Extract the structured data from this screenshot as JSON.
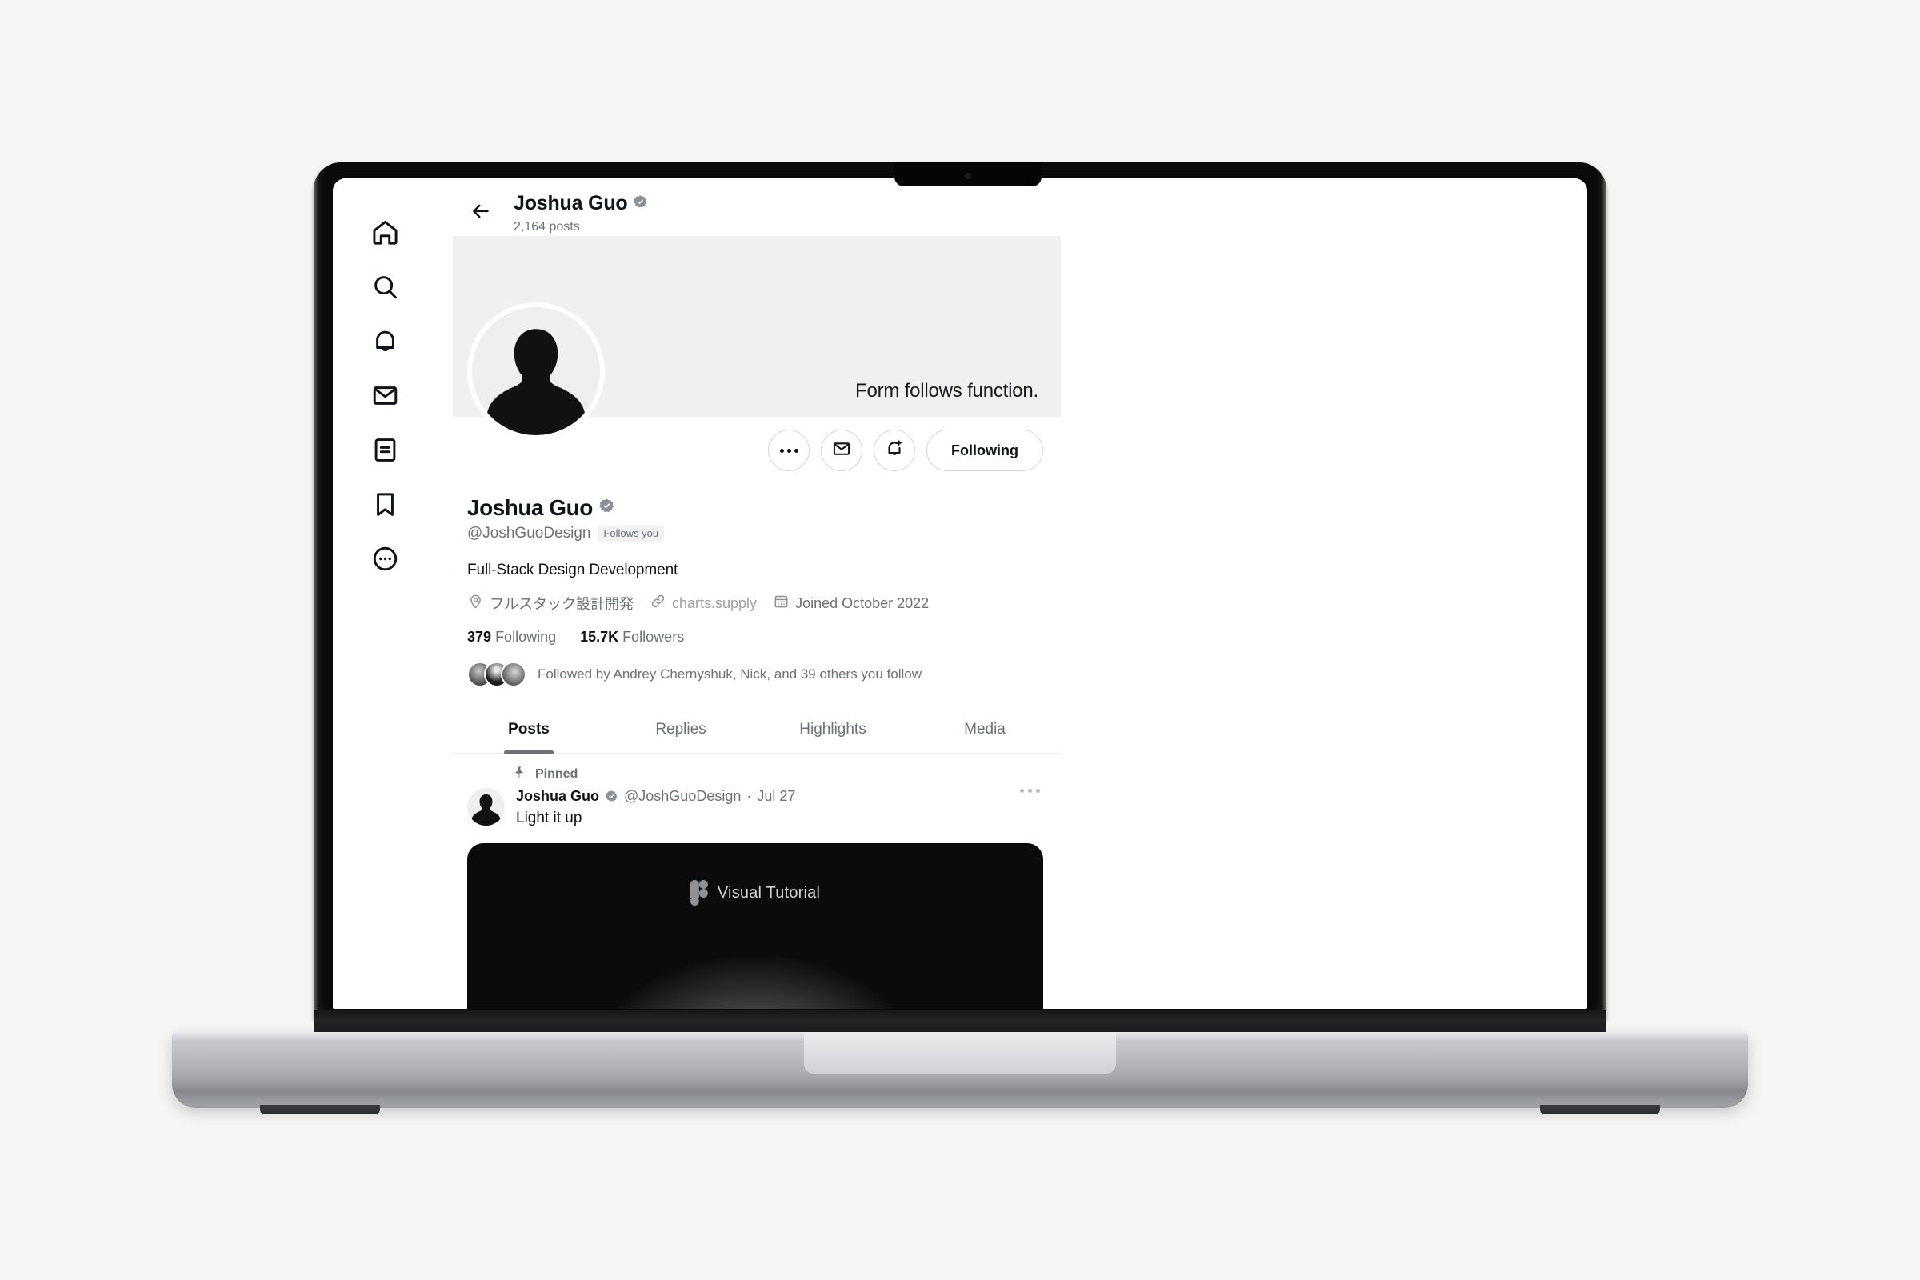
{
  "sidebar": {
    "items": [
      {
        "name": "home",
        "icon": "home-icon",
        "label": "Home"
      },
      {
        "name": "explore",
        "icon": "search-icon",
        "label": "Explore"
      },
      {
        "name": "notifications",
        "icon": "bell-icon",
        "label": "Notifications"
      },
      {
        "name": "messages",
        "icon": "envelope-icon",
        "label": "Messages"
      },
      {
        "name": "grok",
        "icon": "list-document-icon",
        "label": "Grok"
      },
      {
        "name": "bookmarks",
        "icon": "bookmark-icon",
        "label": "Bookmarks"
      },
      {
        "name": "more",
        "icon": "more-circle-icon",
        "label": "More"
      }
    ]
  },
  "topbar": {
    "back_icon": "arrow-left-icon",
    "title": "Joshua Guo",
    "verified_icon": "verified-badge-icon",
    "posts_count": "2,164 posts"
  },
  "banner": {
    "quote": "Form follows function.",
    "color": "#f0f0f0"
  },
  "actions": {
    "more_label": "More",
    "more_icon": "ellipsis-icon",
    "message_icon": "envelope-icon",
    "notify_icon": "bell-plus-icon",
    "follow_label": "Following"
  },
  "profile": {
    "display_name": "Joshua Guo",
    "verified_icon": "verified-badge-icon",
    "handle": "@JoshGuoDesign",
    "follows_you": "Follows you",
    "bio": "Full-Stack Design Development",
    "location": "フルスタック設計開発",
    "location_icon": "location-pin-icon",
    "website": "charts.supply",
    "website_icon": "link-icon",
    "joined": "Joined October 2022",
    "joined_icon": "calendar-icon",
    "following_count": "379",
    "following_label": "Following",
    "followers_count": "15.7K",
    "followers_label": "Followers",
    "followed_by": "Followed by Andrey Chernyshuk, Nick, and 39 others you follow"
  },
  "tabs": [
    {
      "label": "Posts",
      "active": true
    },
    {
      "label": "Replies",
      "active": false
    },
    {
      "label": "Highlights",
      "active": false
    },
    {
      "label": "Media",
      "active": false
    }
  ],
  "post": {
    "pinned_label": "Pinned",
    "pinned_icon": "pin-icon",
    "author": "Joshua Guo",
    "verified_icon": "verified-badge-icon",
    "handle": "@JoshGuoDesign",
    "separator": "·",
    "date": "Jul 27",
    "more_icon": "ellipsis-icon",
    "text": "Light it up",
    "media": {
      "logo_icon": "figma-logo-icon",
      "label": "Visual Tutorial",
      "background": "#0b0b0b"
    }
  },
  "theme": {
    "page_background": "#f5f5f4",
    "screen_background": "#ffffff",
    "text_primary": "#0f1419",
    "text_secondary": "#6b7177",
    "border": "#d3d6d9"
  }
}
